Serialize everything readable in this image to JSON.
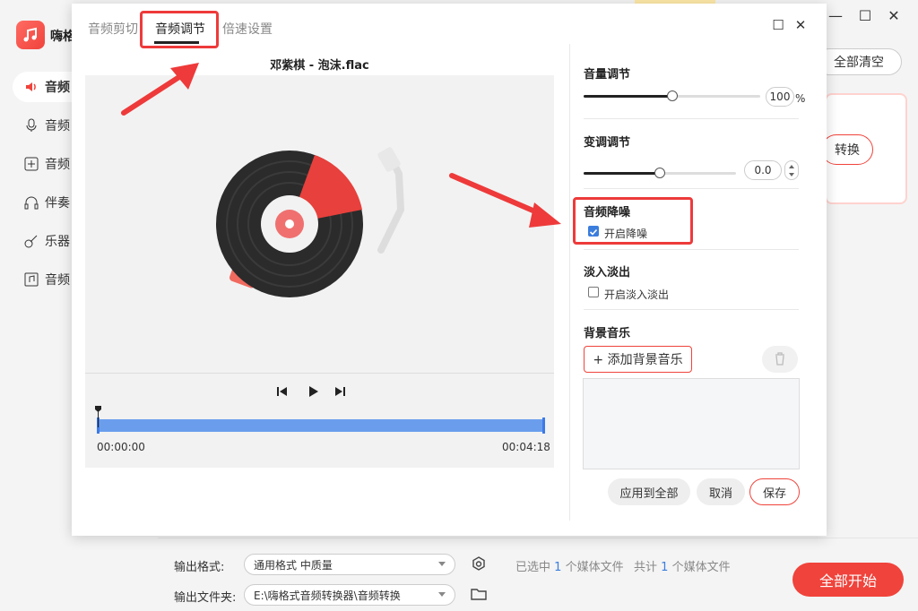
{
  "app": {
    "name": "嗨格",
    "sidebar": [
      "音频",
      "音频",
      "音频",
      "伴奏",
      "乐器",
      "音频"
    ],
    "clear_all": "全部清空",
    "convert": "转换",
    "window_controls": [
      "minimize-icon",
      "maximize-icon",
      "close-icon"
    ]
  },
  "bottom": {
    "format_label": "输出格式:",
    "format_value": "通用格式 中质量",
    "folder_label": "输出文件夹:",
    "folder_value": "E:\\嗨格式音频转换器\\音频转换",
    "selected_pre": "已选中",
    "selected_n": "1",
    "selected_post": "个媒体文件",
    "total_pre": "共计",
    "total_n": "1",
    "total_post": "个媒体文件",
    "start": "全部开始"
  },
  "dialog": {
    "tabs": [
      "音频剪切",
      "音频调节",
      "倍速设置"
    ],
    "active_tab": "音频调节",
    "song_title": "邓紫棋 - 泡沫.flac",
    "time_start": "00:00:00",
    "time_end": "00:04:18",
    "sections": {
      "volume": {
        "title": "音量调节",
        "value": "100",
        "unit": "%",
        "level": 0.5
      },
      "pitch": {
        "title": "变调调节",
        "value": "0.0",
        "level": 0.5
      },
      "denoise": {
        "title": "音频降噪",
        "checkbox": "开启降噪",
        "checked": true
      },
      "fade": {
        "title": "淡入淡出",
        "checkbox": "开启淡入淡出",
        "checked": false
      },
      "bgm": {
        "title": "背景音乐",
        "add": "+ 添加背景音乐"
      }
    },
    "buttons": {
      "apply_all": "应用到全部",
      "cancel": "取消",
      "save": "保存"
    }
  },
  "colors": {
    "accent": "#f0433b",
    "blue": "#3b7ddd",
    "annotation": "#ee3a3a"
  }
}
